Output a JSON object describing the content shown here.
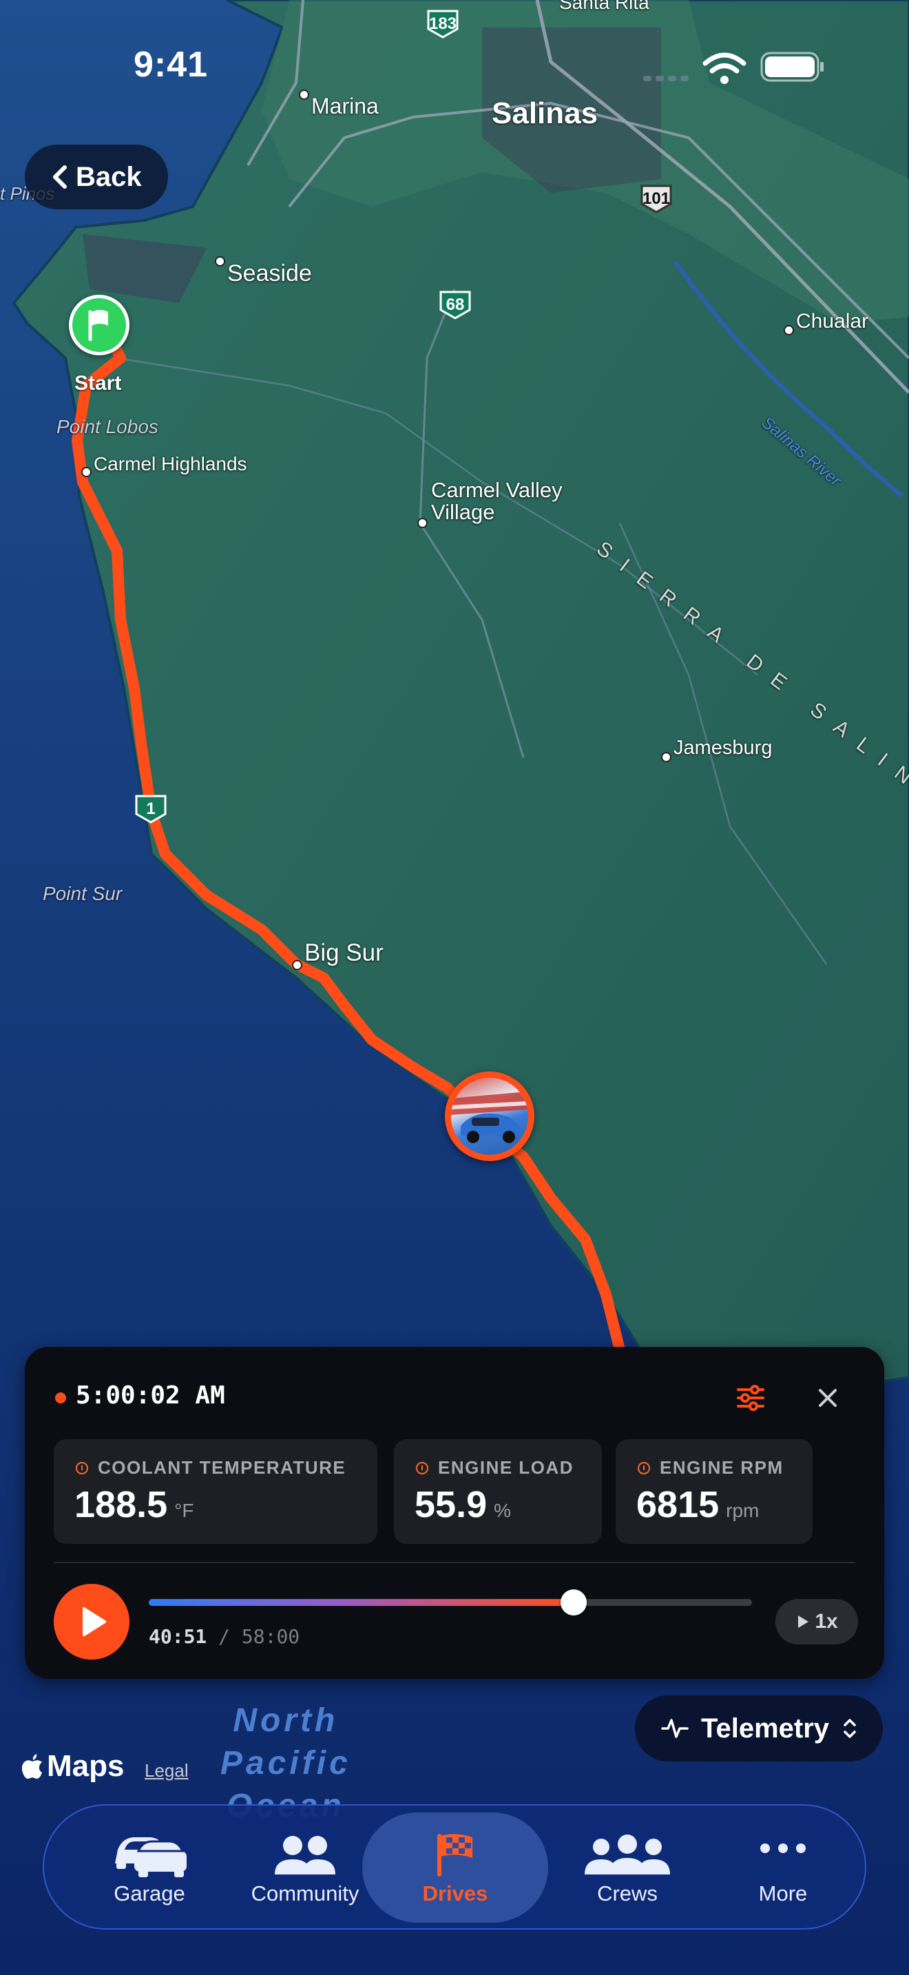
{
  "status_bar": {
    "time": "9:41"
  },
  "nav": {
    "back_label": "Back"
  },
  "map": {
    "places": {
      "salinas": "Salinas",
      "marina": "Marina",
      "seaside": "Seaside",
      "chualar": "Chualar",
      "pacific_grove": "t Pinos",
      "carmel_highlands": "Carmel Highlands",
      "point_lobos": "Point Lobos",
      "carmel_valley": "Carmel Valley\nVillage",
      "jamesburg": "Jamesburg",
      "point_sur": "Point Sur",
      "big_sur": "Big Sur",
      "santa_rita": "Santa Rita",
      "salinas_river": "Salinas River",
      "sierra_de_salinas": "SIERRA DE SALINAS",
      "ocean": "North\nPacific\nOcean"
    },
    "highways": [
      "183",
      "101",
      "68",
      "1"
    ],
    "start_label": "Start",
    "route_color": "#ff4d1a"
  },
  "telemetry_panel": {
    "timestamp": "5:00:02 AM",
    "metrics": [
      {
        "label": "COOLANT TEMPERATURE",
        "value": "188.5",
        "unit": "°F"
      },
      {
        "label": "ENGINE LOAD",
        "value": "55.9",
        "unit": "%"
      },
      {
        "label": "ENGINE RPM",
        "value": "6815",
        "unit": "rpm"
      }
    ],
    "playback": {
      "current": "40:51",
      "separator": "/",
      "total": "58:00",
      "progress": 0.704,
      "speed": "1x"
    }
  },
  "attribution": {
    "maps": "Maps",
    "legal": "Legal"
  },
  "mode_selector": {
    "label": "Telemetry"
  },
  "tabbar": {
    "tabs": [
      {
        "label": "Garage",
        "icon": "car-icon"
      },
      {
        "label": "Community",
        "icon": "people-icon"
      },
      {
        "label": "Drives",
        "icon": "checkered-flag-icon",
        "active": true
      },
      {
        "label": "Crews",
        "icon": "group-icon"
      },
      {
        "label": "More",
        "icon": "ellipsis-icon"
      }
    ]
  },
  "colors": {
    "accent": "#ff4d1a",
    "land": "#2a6a5e",
    "water": "#0d2d6b",
    "panel": "#0b0d12"
  }
}
